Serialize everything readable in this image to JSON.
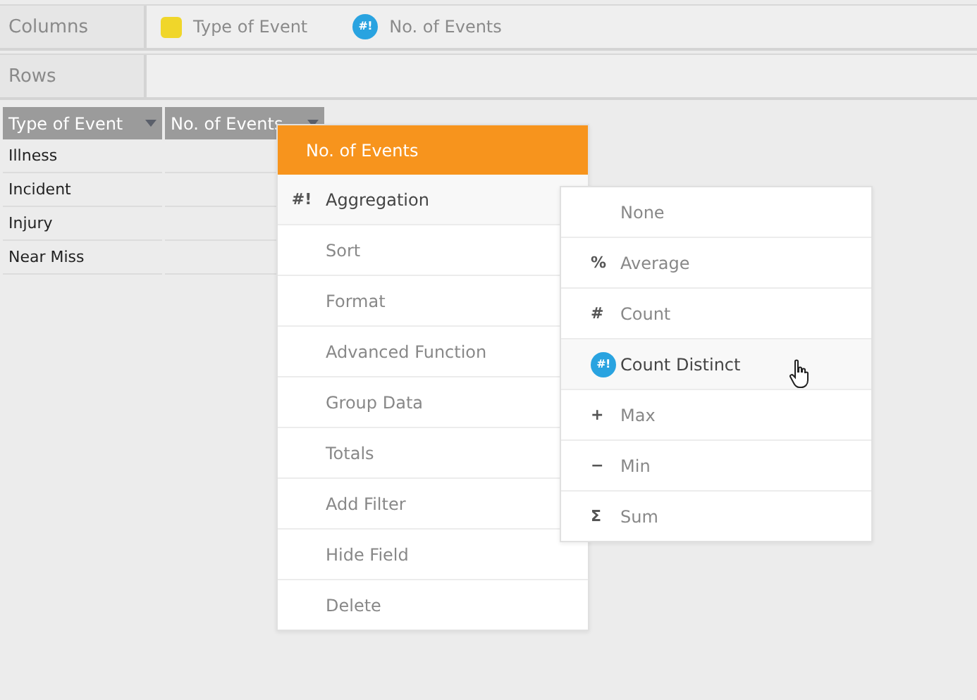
{
  "columns_bar": {
    "label": "Columns",
    "fields": [
      {
        "label": "Type of Event",
        "kind": "dimension",
        "color": "#f0d62a"
      },
      {
        "label": "No. of Events",
        "kind": "metric",
        "icon": "#!",
        "color": "#29a3e0"
      }
    ]
  },
  "rows_bar": {
    "label": "Rows"
  },
  "table": {
    "columns": [
      "Type of Event",
      "No. of Events"
    ],
    "rows": [
      "Illness",
      "Incident",
      "Injury",
      "Near Miss"
    ]
  },
  "field_menu": {
    "title": "No. of Events",
    "items": [
      {
        "label": "Aggregation",
        "icon": "#!",
        "selected": true
      },
      {
        "label": "Sort",
        "selected": false
      },
      {
        "label": "Format",
        "selected": false
      },
      {
        "label": "Advanced Function",
        "selected": false
      },
      {
        "label": "Group Data",
        "selected": false
      },
      {
        "label": "Totals",
        "selected": false
      },
      {
        "label": "Add Filter",
        "selected": false
      },
      {
        "label": "Hide Field",
        "selected": false
      },
      {
        "label": "Delete",
        "selected": false
      }
    ]
  },
  "aggregation_menu": {
    "items": [
      {
        "label": "None",
        "selected": false
      },
      {
        "label": "Average",
        "icon": "%",
        "selected": false
      },
      {
        "label": "Count",
        "icon": "#",
        "selected": false
      },
      {
        "label": "Count Distinct",
        "icon": "#!",
        "selected": true,
        "badge": true
      },
      {
        "label": "Max",
        "icon": "+",
        "selected": false
      },
      {
        "label": "Min",
        "icon": "−",
        "selected": false
      },
      {
        "label": "Sum",
        "icon": "Σ",
        "selected": false
      }
    ]
  }
}
